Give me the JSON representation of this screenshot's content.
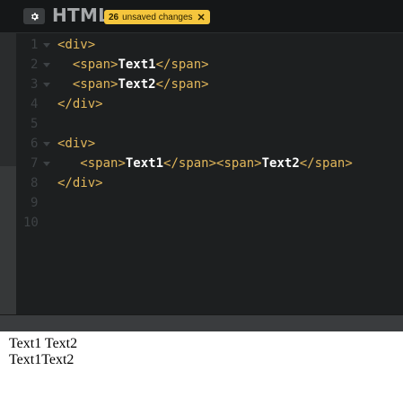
{
  "header": {
    "settings_icon": "gear-icon",
    "title": "HTML",
    "unsaved_count": "26",
    "unsaved_label": "unsaved changes",
    "unsaved_close": "✕"
  },
  "editor": {
    "lines": [
      {
        "num": "1",
        "fold": true,
        "indent": "",
        "parts": [
          {
            "t": "tag",
            "v": "<div>"
          }
        ]
      },
      {
        "num": "2",
        "fold": true,
        "indent": "  ",
        "parts": [
          {
            "t": "tag",
            "v": "<span>"
          },
          {
            "t": "txt",
            "v": "Text1"
          },
          {
            "t": "tag",
            "v": "</span>"
          }
        ]
      },
      {
        "num": "3",
        "fold": true,
        "indent": "  ",
        "parts": [
          {
            "t": "tag",
            "v": "<span>"
          },
          {
            "t": "txt",
            "v": "Text2"
          },
          {
            "t": "tag",
            "v": "</span>"
          }
        ]
      },
      {
        "num": "4",
        "fold": false,
        "indent": "",
        "parts": [
          {
            "t": "tag",
            "v": "</div>"
          }
        ]
      },
      {
        "num": "5",
        "fold": false,
        "indent": "",
        "parts": []
      },
      {
        "num": "6",
        "fold": true,
        "indent": "",
        "parts": [
          {
            "t": "tag",
            "v": "<div>"
          }
        ]
      },
      {
        "num": "7",
        "fold": true,
        "indent": "   ",
        "parts": [
          {
            "t": "tag",
            "v": "<span>"
          },
          {
            "t": "txt",
            "v": "Text1"
          },
          {
            "t": "tag",
            "v": "</span><span>"
          },
          {
            "t": "txt",
            "v": "Text2"
          },
          {
            "t": "tag",
            "v": "</span>"
          }
        ]
      },
      {
        "num": "8",
        "fold": false,
        "indent": "",
        "parts": [
          {
            "t": "tag",
            "v": "</div>"
          }
        ]
      },
      {
        "num": "9",
        "fold": false,
        "indent": "",
        "parts": []
      },
      {
        "num": "10",
        "fold": false,
        "indent": "",
        "parts": []
      }
    ]
  },
  "preview": {
    "line1": "Text1 Text2",
    "line2": "Text1Text2"
  },
  "colors": {
    "tag": "#e2b75a",
    "text": "#ffffff",
    "badge": "#f5c63d",
    "editor_bg": "#1d1f20"
  }
}
